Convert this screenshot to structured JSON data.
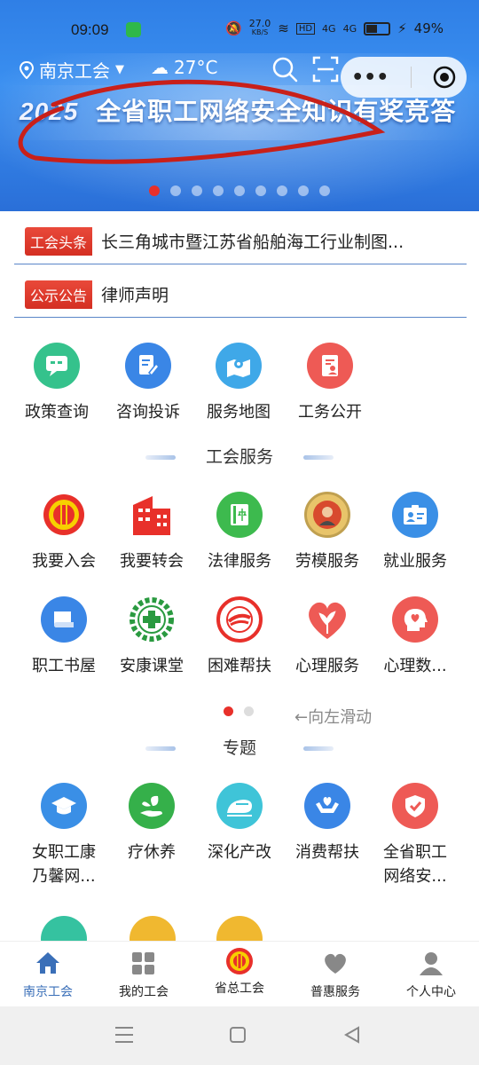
{
  "status_bar": {
    "time": "09:09",
    "net_speed": "27.0",
    "net_unit": "KB/S",
    "signal1": "4G",
    "signal2": "4G",
    "hd": "HD",
    "battery": "49%"
  },
  "header": {
    "location": "南京工会",
    "weather": "27°C"
  },
  "banner": {
    "year": "2025",
    "title": "全省职工网络安全知识有奖竞答",
    "slide_count": 9,
    "active_slide": 0
  },
  "news": [
    {
      "tag": "工会头条",
      "text": "长三角城市暨江苏省船舶海工行业制图..."
    },
    {
      "tag": "公示公告",
      "text": "律师声明"
    }
  ],
  "quick_links": [
    {
      "label": "政策查询",
      "icon": "chat-doc-icon",
      "color": "#35c28c"
    },
    {
      "label": "咨询投诉",
      "icon": "edit-doc-icon",
      "color": "#3a86e6"
    },
    {
      "label": "服务地图",
      "icon": "map-icon",
      "color": "#3fa8e8"
    },
    {
      "label": "工务公开",
      "icon": "doc-person-icon",
      "color": "#ee5a55"
    }
  ],
  "service_section": {
    "title": "工会服务",
    "items": [
      {
        "label": "我要入会",
        "icon": "union-emblem-icon"
      },
      {
        "label": "我要转会",
        "icon": "building-icon"
      },
      {
        "label": "法律服务",
        "icon": "law-book-icon"
      },
      {
        "label": "劳模服务",
        "icon": "model-worker-medal-icon"
      },
      {
        "label": "就业服务",
        "icon": "id-card-icon"
      },
      {
        "label": "职工书屋",
        "icon": "book-icon"
      },
      {
        "label": "安康课堂",
        "icon": "health-cross-icon"
      },
      {
        "label": "困难帮扶",
        "icon": "help-seal-icon"
      },
      {
        "label": "心理服务",
        "icon": "heart-plant-icon"
      },
      {
        "label": "心理数...",
        "icon": "head-heart-icon"
      }
    ],
    "page_indicator_active": 0,
    "swipe_hint": "←向左滑动"
  },
  "topic_section": {
    "title": "专题",
    "items": [
      {
        "label": "女职工康",
        "label2": "乃馨网...",
        "icon": "graduation-cap-icon"
      },
      {
        "label": "疗休养",
        "label2": "",
        "icon": "leaf-hand-icon"
      },
      {
        "label": "深化产改",
        "label2": "",
        "icon": "train-icon"
      },
      {
        "label": "消费帮扶",
        "label2": "",
        "icon": "hands-heart-icon"
      },
      {
        "label": "全省职工",
        "label2": "网络安...",
        "icon": "shield-check-icon"
      }
    ]
  },
  "tabbar": [
    {
      "label": "南京工会",
      "icon": "home-icon",
      "active": true
    },
    {
      "label": "我的工会",
      "icon": "grid-icon",
      "active": false
    },
    {
      "label": "省总工会",
      "icon": "union-emblem-icon",
      "active": false
    },
    {
      "label": "普惠服务",
      "icon": "heart-icon",
      "active": false
    },
    {
      "label": "个人中心",
      "icon": "person-icon",
      "active": false
    }
  ],
  "colors": {
    "accent_red": "#e8302a",
    "tab_active": "#3a6fb8",
    "banner_blue": "#2f7fe6"
  }
}
